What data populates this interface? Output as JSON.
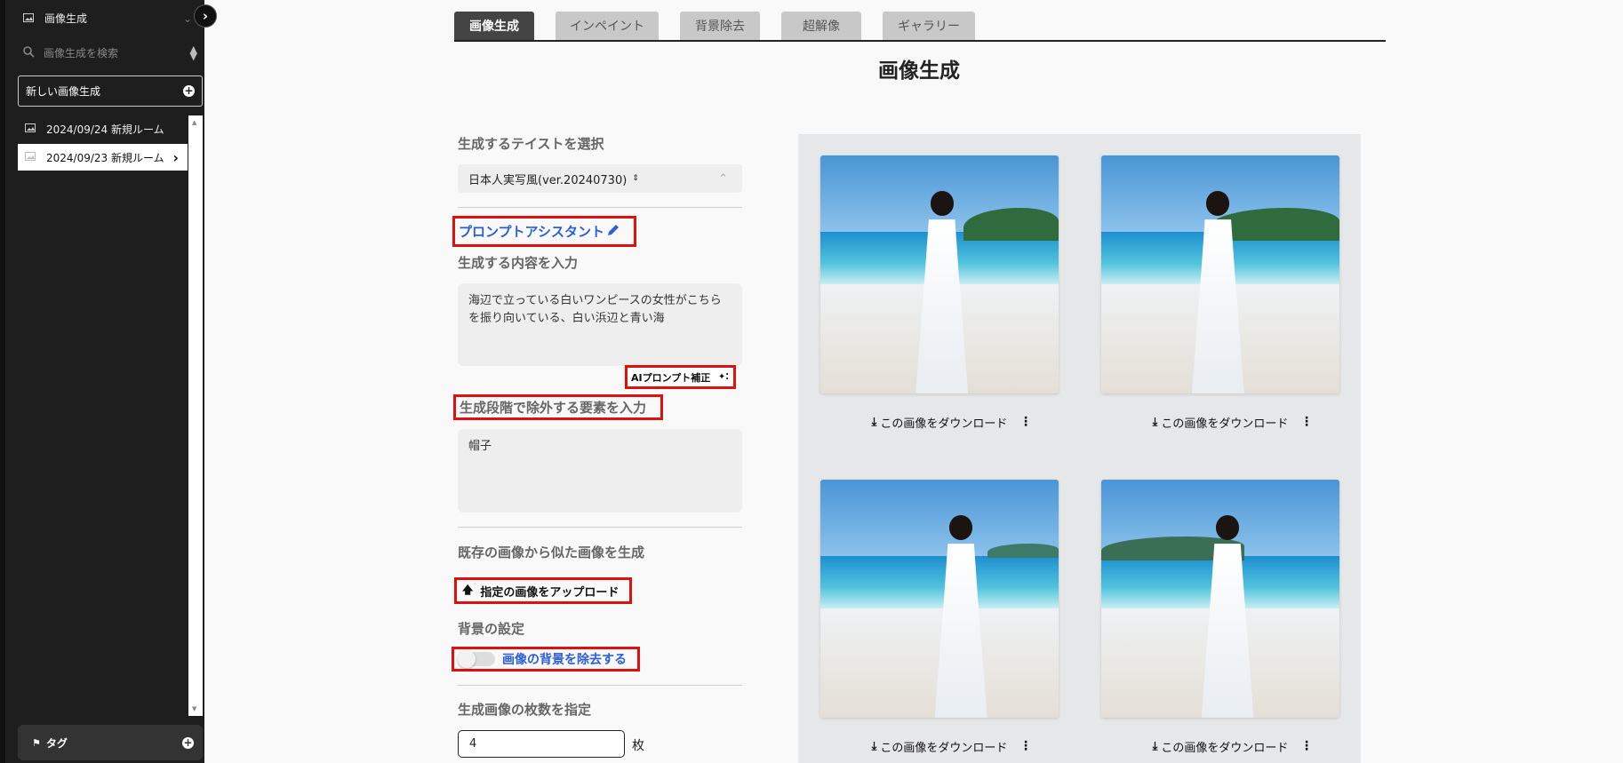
{
  "sidebar": {
    "section_label": "画像生成",
    "search_placeholder": "画像生成を検索",
    "new_button_label": "新しい画像生成",
    "rooms": [
      {
        "label": "2024/09/24 新規ルーム"
      },
      {
        "label": "2024/09/23 新規ルーム"
      }
    ],
    "tag_label": "タグ"
  },
  "tabs": [
    "画像生成",
    "インペイント",
    "背景除去",
    "超解像",
    "ギャラリー"
  ],
  "active_tab": "画像生成",
  "page_title": "画像生成",
  "form": {
    "taste_title": "生成するテイストを選択",
    "taste_value": "日本人実写風(ver.20240730)",
    "prompt_assistant_label": "プロンプトアシスタント",
    "content_title": "生成する内容を入力",
    "content_value": "海辺で立っている白いワンピースの女性がこちらを振り向いている、白い浜辺と青い海",
    "ai_fix_label": "AIプロンプト補正",
    "exclude_title": "生成段階で除外する要素を入力",
    "exclude_value": "帽子",
    "similar_title": "既存の画像から似た画像を生成",
    "upload_label": "指定の画像をアップロード",
    "bg_title": "背景の設定",
    "bg_toggle_label": "画像の背景を除去する",
    "count_title": "生成画像の枚数を指定",
    "count_value": "4",
    "count_unit": "枚"
  },
  "gallery": {
    "download_label": "この画像をダウンロード",
    "image_count": 4
  },
  "colors": {
    "sidebar_bg": "#1e1e1e",
    "highlight_red": "#e01010",
    "link_blue": "#2b5fd9",
    "active_tab_bg": "#444444"
  }
}
